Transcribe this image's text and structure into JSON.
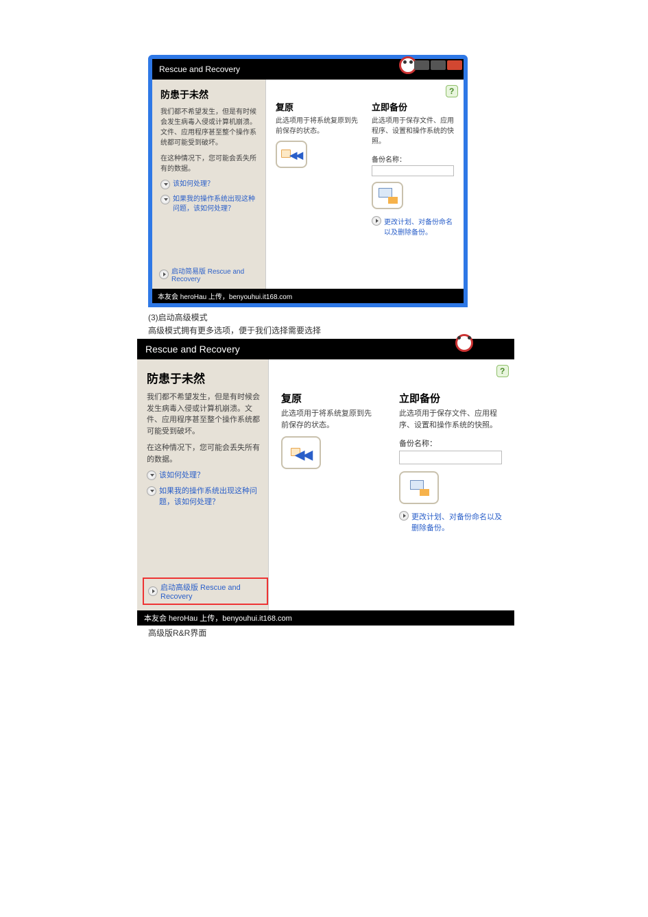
{
  "app_title": "Rescue and Recovery",
  "sidebar": {
    "heading": "防患于未然",
    "intro": "我们都不希望发生，但是有时候会发生病毒入侵或计算机崩溃。文件、应用程序甚至整个操作系统都可能受到破坏。",
    "warn_line": "在这种情况下，您可能会丢失所有的数据。",
    "link_how": "该如何处理？",
    "link_if": "如果我的操作系统出现这种问题，该如何处理？",
    "launch_small": "启动简易版 Rescue and Recovery",
    "launch_large": "启动高级版 Rescue and Recovery"
  },
  "restore": {
    "title": "复原",
    "desc": "此选项用于将系统复原到先前保存的状态。"
  },
  "backup": {
    "title": "立即备份",
    "desc": "此选项用于保存文件、应用程序、设置和操作系统的快照。",
    "name_label": "备份名称：",
    "plan_link": "更改计划、对备份命名以及删除备份。"
  },
  "footer_caption": "本友会 heroHau 上传，benyouhui.it168.com",
  "annotations": {
    "step": "(3)启动高级模式",
    "step_desc": "高级模式拥有更多选项，便于我们选择需要选择",
    "bottom": "高级版R&R界面"
  }
}
